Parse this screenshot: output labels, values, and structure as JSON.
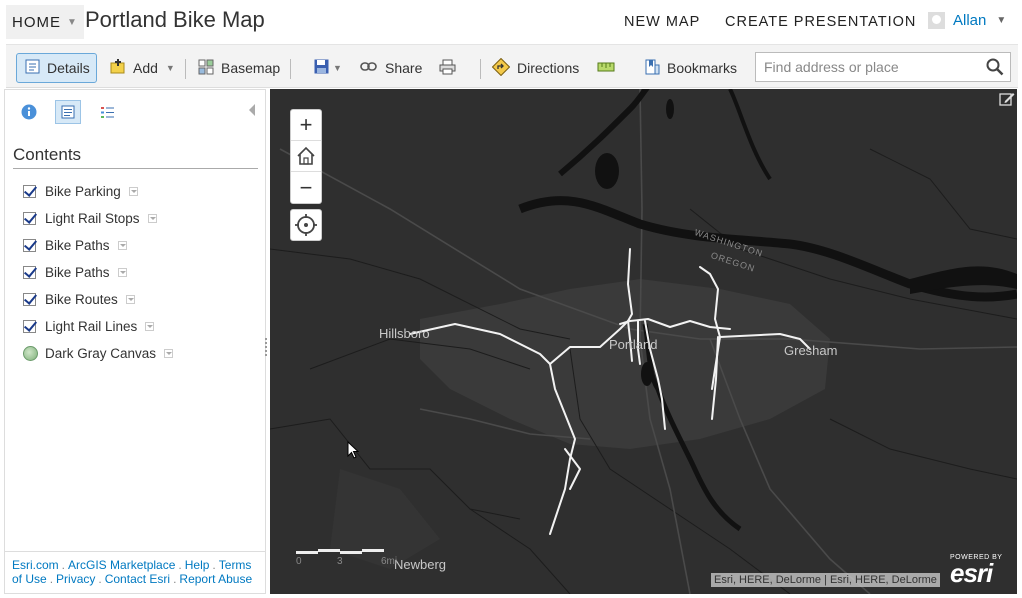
{
  "header": {
    "home_label": "HOME",
    "title": "Portland Bike Map",
    "nav": [
      "NEW MAP",
      "CREATE PRESENTATION"
    ],
    "user_name": "Allan"
  },
  "toolbar": {
    "details_label": "Details",
    "add_label": "Add",
    "basemap_label": "Basemap",
    "share_label": "Share",
    "directions_label": "Directions",
    "bookmarks_label": "Bookmarks",
    "search_placeholder": "Find address or place"
  },
  "sidebar": {
    "contents_title": "Contents",
    "layers": [
      {
        "label": "Bike Parking",
        "type": "checkbox",
        "checked": true
      },
      {
        "label": "Light Rail Stops",
        "type": "checkbox",
        "checked": true
      },
      {
        "label": "Bike Paths",
        "type": "checkbox",
        "checked": true
      },
      {
        "label": "Bike Paths",
        "type": "checkbox",
        "checked": true
      },
      {
        "label": "Bike Routes",
        "type": "checkbox",
        "checked": true
      },
      {
        "label": "Light Rail Lines",
        "type": "checkbox",
        "checked": true
      },
      {
        "label": "Dark Gray Canvas",
        "type": "basemap"
      }
    ],
    "footer": {
      "links": [
        "Esri.com",
        "ArcGIS Marketplace",
        "Help",
        "Terms of Use",
        "Privacy",
        "Contact Esri",
        "Report Abuse"
      ]
    }
  },
  "map": {
    "place_labels": [
      "Hillsboro",
      "Portland",
      "Gresham",
      "Newberg"
    ],
    "river_label_1": "WASHINGTON",
    "river_label_2": "OREGON",
    "scale_ticks": [
      "0",
      "3",
      "6mi"
    ],
    "attribution": "Esri, HERE, DeLorme | Esri, HERE, DeLorme",
    "powered_by": "POWERED BY",
    "esri_logo": "esri",
    "colors": {
      "background": "#2f2f2f",
      "water": "#111111",
      "route": "#f2f2f2"
    }
  }
}
